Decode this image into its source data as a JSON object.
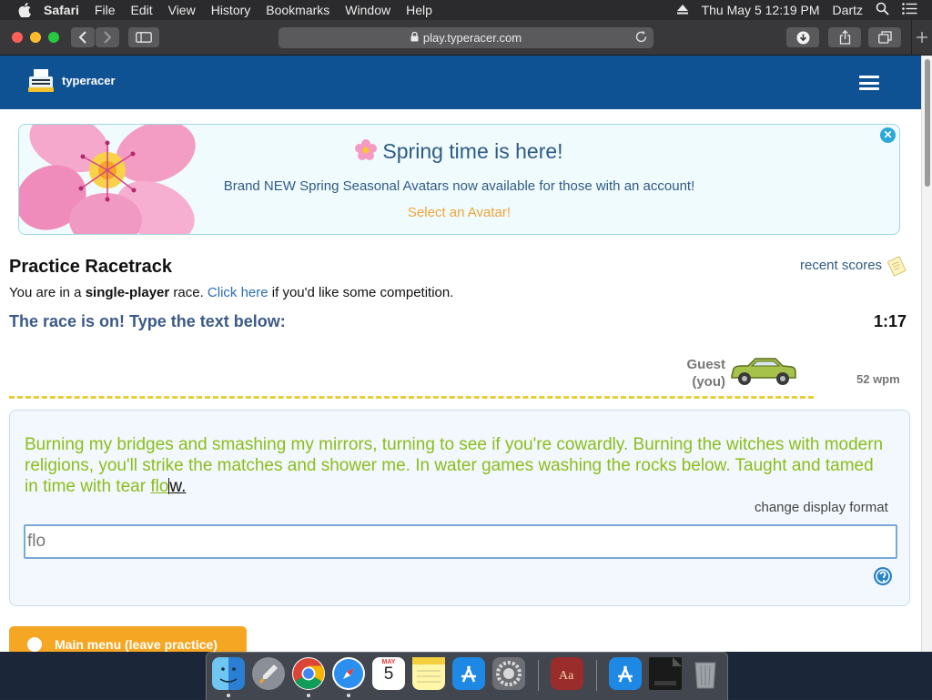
{
  "menubar": {
    "app": "Safari",
    "items": [
      "File",
      "Edit",
      "View",
      "History",
      "Bookmarks",
      "Window",
      "Help"
    ],
    "datetime": "Thu May 5  12:19 PM",
    "user": "Dartz"
  },
  "browser": {
    "url": "play.typeracer.com"
  },
  "site": {
    "logo_text": "typeracer"
  },
  "banner": {
    "title": "Spring time is here!",
    "subtitle": "Brand NEW Spring Seasonal Avatars now available for those with an account!",
    "link": "Select an Avatar!",
    "close": "✕"
  },
  "practice": {
    "title": "Practice Racetrack",
    "recent_scores": "recent scores",
    "intro_pre": "You are in a ",
    "intro_bold": "single-player",
    "intro_mid": " race. ",
    "intro_link": "Click here",
    "intro_post": " if you'd like some competition.",
    "race_on": "The race is on! Type the text below:",
    "timer": "1:17"
  },
  "racer": {
    "name": "Guest",
    "you": "(you)",
    "wpm": "52 wpm"
  },
  "passage": {
    "completed": "Burning my bridges and smashing my mirrors, turning to see if you're cowardly. Burning the witches with modern religions, you'll strike the matches and shower me. In water games washing the rocks below. Taught and tamed in time with tear ",
    "current_typed": "flo",
    "current_rest": "w.",
    "change_format": "change display format"
  },
  "input": {
    "value": "flo"
  },
  "buttons": {
    "main_menu": "Main menu (leave practice)"
  },
  "dock": {
    "calendar_month": "MAY",
    "calendar_day": "5"
  },
  "colors": {
    "header": "#0f5294",
    "typed_text": "#8bbd1b",
    "banner_link": "#f0a33a",
    "race_on": "#3b5a88"
  }
}
